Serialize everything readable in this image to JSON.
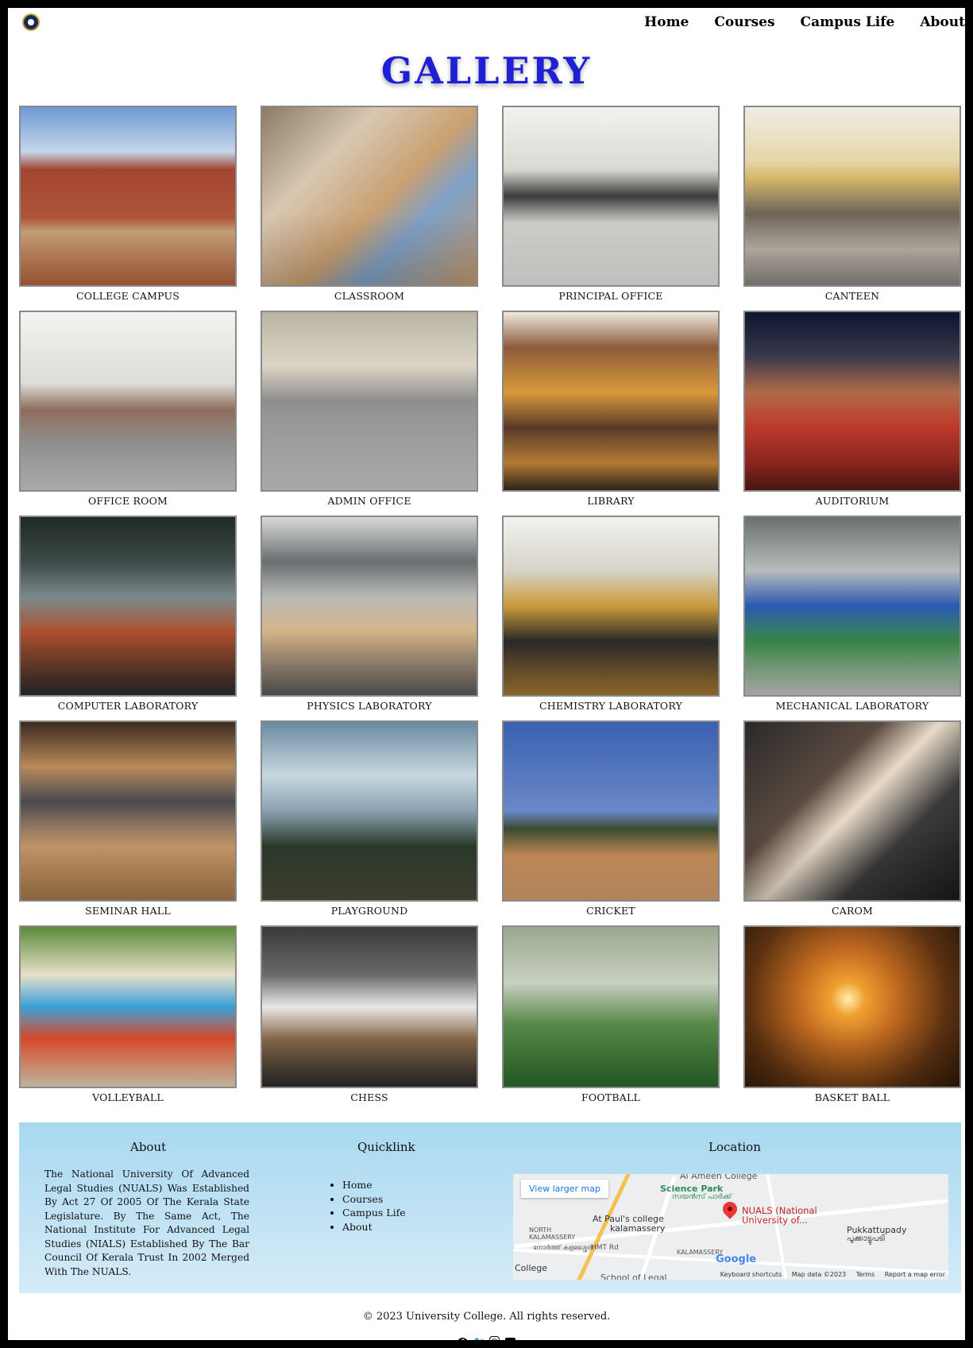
{
  "nav": {
    "items": [
      {
        "label": "Home"
      },
      {
        "label": "Courses"
      },
      {
        "label": "Campus Life"
      },
      {
        "label": "About"
      }
    ]
  },
  "page": {
    "title": "GALLERY"
  },
  "gallery": {
    "items": [
      {
        "caption": "COLLEGE CAMPUS"
      },
      {
        "caption": "CLASSROOM"
      },
      {
        "caption": "PRINCIPAL OFFICE"
      },
      {
        "caption": "CANTEEN"
      },
      {
        "caption": "OFFICE ROOM"
      },
      {
        "caption": "ADMIN OFFICE"
      },
      {
        "caption": "LIBRARY"
      },
      {
        "caption": "AUDITORIUM"
      },
      {
        "caption": "COMPUTER LABORATORY"
      },
      {
        "caption": "PHYSICS LABORATORY"
      },
      {
        "caption": "CHEMISTRY LABORATORY"
      },
      {
        "caption": "MECHANICAL LABORATORY"
      },
      {
        "caption": "SEMINAR HALL"
      },
      {
        "caption": "PLAYGROUND"
      },
      {
        "caption": "CRICKET"
      },
      {
        "caption": "CAROM"
      },
      {
        "caption": "VOLLEYBALL"
      },
      {
        "caption": "CHESS"
      },
      {
        "caption": "FOOTBALL"
      },
      {
        "caption": "BASKET BALL"
      }
    ]
  },
  "footer": {
    "about_title": "About",
    "about_text": "The National University Of Advanced Legal Studies (NUALS) Was Established By Act 27 Of 2005 Of The Kerala State Legislature. By The Same Act, The National Institute For Advanced Legal Studies (NIALS) Established By The Bar Council Of Kerala Trust In 2002 Merged With The NUALS.",
    "quicklink_title": "Quicklink",
    "quicklinks": [
      {
        "label": "Home"
      },
      {
        "label": "Courses"
      },
      {
        "label": "Campus Life"
      },
      {
        "label": "About"
      }
    ],
    "location_title": "Location",
    "map": {
      "larger_map_label": "View larger map",
      "place_top": "Al Ameen College",
      "science_park": "Science Park",
      "science_park_ml": "സയൻസ് പാർക്ക്",
      "at_pauls": "At Paul's college",
      "kalamassery": "kalamassery",
      "nuals_pin": "NUALS (National University of...",
      "north_kalamassery": "NORTH KALAMASSERY",
      "north_kalamassery_ml": "നോർത്ത് കളമശ്ശേരി",
      "pukkattupady": "Pukkattupady",
      "pukkattupady_ml": "പൂക്കാട്ടുപടി",
      "hmt_rd": "HMT Rd",
      "kalamassery_caps": "KALAMASSERY",
      "college": "College",
      "school_of_legal": "School of Legal",
      "google": "Google",
      "keyboard_shortcuts": "Keyboard shortcuts",
      "map_data": "Map data ©2023",
      "terms": "Terms",
      "report": "Report a map error"
    },
    "copyright": "© 2023 University College. All rights reserved.",
    "social": [
      {
        "icon": "facebook-icon",
        "glyph": "f"
      },
      {
        "icon": "twitter-icon",
        "glyph": "🐦"
      },
      {
        "icon": "instagram-icon",
        "glyph": "◎"
      },
      {
        "icon": "linkedin-icon",
        "glyph": "in"
      }
    ]
  },
  "colors": {
    "title": "#1f1fd6",
    "footer_top": "#a8d8f0",
    "footer_bottom": "#d5ebf8"
  }
}
